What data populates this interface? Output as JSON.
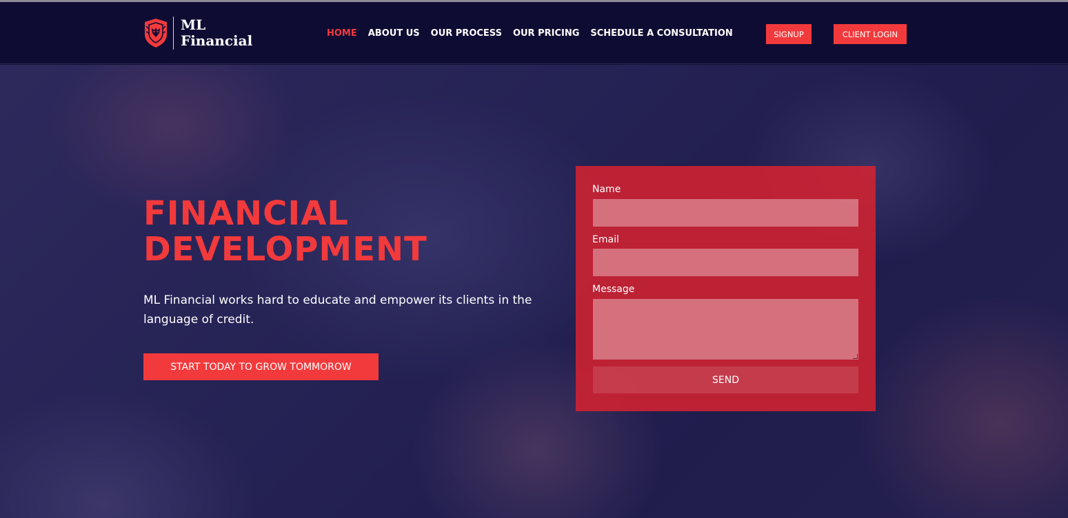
{
  "colors": {
    "navy": "#0f0c33",
    "accent": "#f23a3c",
    "form_bg": "#d62230",
    "white": "#ffffff"
  },
  "header": {
    "logo": {
      "icon": "lion-shield-icon",
      "line1": "ML",
      "line2": "Financial"
    },
    "nav": [
      {
        "label": "HOME",
        "active": true
      },
      {
        "label": "ABOUT US",
        "active": false
      },
      {
        "label": "OUR PROCESS",
        "active": false
      },
      {
        "label": "OUR PRICING",
        "active": false
      },
      {
        "label": "SCHEDULE A CONSULTATION",
        "active": false
      }
    ],
    "signup_label": "SIGNUP",
    "login_label": "CLIENT LOGIN"
  },
  "hero": {
    "title_line1": "FINANCIAL",
    "title_line2": "DEVELOPMENT",
    "description": "ML Financial works hard to educate and empower its clients in the language of credit.",
    "cta_label": "START TODAY TO GROW TOMMOROW"
  },
  "form": {
    "name_label": "Name",
    "name_value": "",
    "email_label": "Email",
    "email_value": "",
    "message_label": "Message",
    "message_value": "",
    "send_label": "SEND"
  }
}
